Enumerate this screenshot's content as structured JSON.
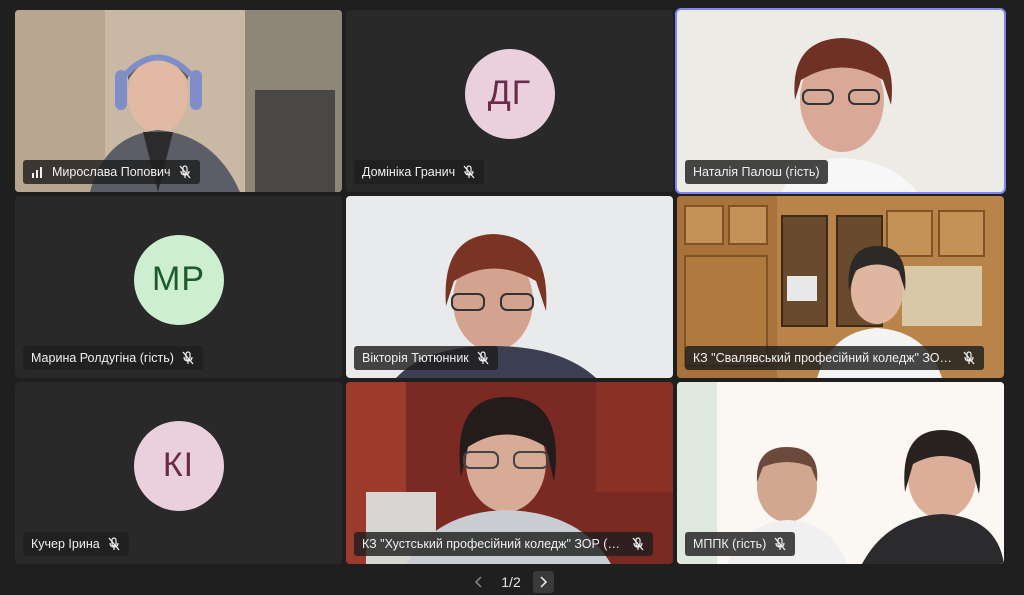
{
  "participants": [
    {
      "name": "Мирослава Попович",
      "initials": "",
      "mic": "muted",
      "signal": true
    },
    {
      "name": "Домініка Гранич",
      "initials": "ДГ",
      "mic": "muted",
      "avatar_bg": "#e9d0dc",
      "avatar_fg": "#6b2a47"
    },
    {
      "name": "Наталія Палош (гість)",
      "initials": "",
      "mic": "none",
      "active": true
    },
    {
      "name": "Марина Ролдугіна (гість)",
      "initials": "МР",
      "mic": "muted",
      "avatar_bg": "#cdeecf",
      "avatar_fg": "#1d5b2a"
    },
    {
      "name": "Вікторія Тютюнник",
      "initials": "",
      "mic": "muted"
    },
    {
      "name": "КЗ \"Свалявський професійний коледж\" ЗОР...",
      "initials": "",
      "mic": "muted"
    },
    {
      "name": "Кучер Ірина",
      "initials": "КІ",
      "mic": "muted",
      "avatar_bg": "#e9d0dc",
      "avatar_fg": "#6b2a47"
    },
    {
      "name": "КЗ \"Хустський професійний коледж\" ЗОР (гі...",
      "initials": "",
      "mic": "muted"
    },
    {
      "name": "МППК (гість)",
      "initials": "",
      "mic": "muted"
    }
  ],
  "pager": {
    "label": "1/2"
  },
  "colors": {
    "active_border": "#7f85f5",
    "background": "#1f1f1f"
  }
}
